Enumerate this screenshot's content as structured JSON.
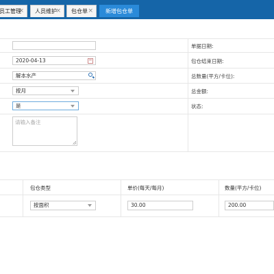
{
  "tabs": [
    {
      "label": "员工管理",
      "closable": true,
      "active": false
    },
    {
      "label": "人员维护",
      "closable": true,
      "active": false
    },
    {
      "label": "包仓单",
      "closable": true,
      "active": false
    },
    {
      "label": "新增包仓单",
      "closable": false,
      "active": true
    }
  ],
  "close_glyph": "×",
  "form": {
    "field1_value": "",
    "start_date_value": "2020-04-13",
    "store_value": "解本水产",
    "billing_mode_value": "按月",
    "flag_value": "是",
    "remark_placeholder": "请输入备注",
    "labels": {
      "doc_date": "单据日期:",
      "end_date": "包仓结束日期:",
      "total_qty": "总数量(平方/卡位):",
      "total_amount": "总金额:",
      "status": "状态:"
    }
  },
  "table": {
    "headers": {
      "type": "包仓类型",
      "unit_price": "单价(每天/每月)",
      "qty": "数量(平方/卡位)"
    },
    "rows": [
      {
        "type": "按面积",
        "unit_price": "30.00",
        "qty": "200.00"
      }
    ]
  },
  "colors": {
    "tabbar": "#1565a8",
    "active_tab": "#2a8ad9"
  }
}
